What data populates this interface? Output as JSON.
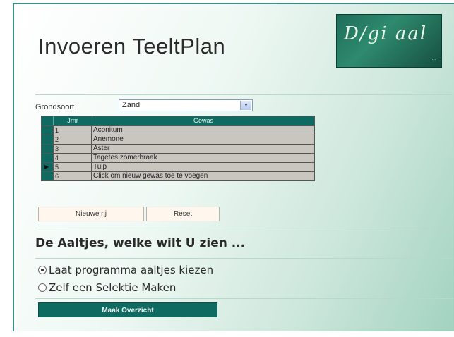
{
  "page": {
    "title": "Invoeren TeeltPlan",
    "logo_text": "D/gi aal",
    "logo_subtext": "..."
  },
  "form": {
    "grondsoort_label": "Grondsoort",
    "grondsoort_value": "Zand"
  },
  "grid": {
    "columns": [
      "Jrnr",
      "Gewas"
    ],
    "rows": [
      {
        "nr": "1",
        "gewas": "Aconitum"
      },
      {
        "nr": "2",
        "gewas": "Anemone"
      },
      {
        "nr": "3",
        "gewas": "Aster"
      },
      {
        "nr": "4",
        "gewas": "Tagetes zomerbraak"
      },
      {
        "nr": "5",
        "gewas": "Tulp"
      },
      {
        "nr": "6",
        "gewas": "Click om nieuw gewas toe te voegen"
      }
    ],
    "current_row_index": 4
  },
  "buttons": {
    "nieuw": "Nieuwe rij",
    "reset": "Reset",
    "maak": "Maak Overzicht"
  },
  "section": {
    "heading": "De Aaltjes, welke wilt U zien ...",
    "options": [
      {
        "label": "Laat programma aaltjes kiezen",
        "selected": true
      },
      {
        "label": "Zelf een Selektie Maken",
        "selected": false
      }
    ]
  },
  "colors": {
    "teal": "#0f6b62",
    "grid_cell": "#c9c6c0"
  }
}
